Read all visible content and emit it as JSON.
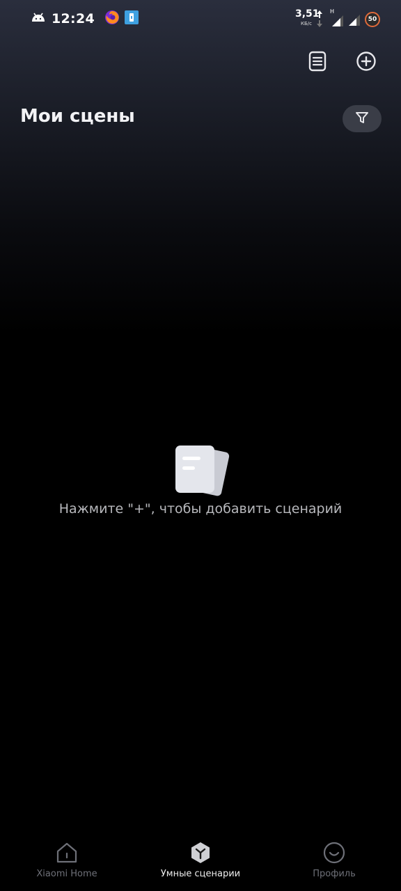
{
  "status_bar": {
    "time": "12:24",
    "net_speed": "3,51",
    "net_speed_unit": "КБ/с",
    "network_type": "H",
    "battery": "50",
    "icons": [
      "android-icon",
      "firefox-icon",
      "notification-app-icon",
      "upload-arrow-icon",
      "signal-icon",
      "signal-icon",
      "battery-icon"
    ]
  },
  "header": {
    "title": "Мои сцены",
    "actions": [
      "log-icon",
      "add-icon",
      "filter-icon"
    ]
  },
  "empty_state": {
    "message": "Нажмите \"+\", чтобы добавить сценарий",
    "icon": "empty-documents-icon"
  },
  "bottom_nav": {
    "items": [
      {
        "label": "Xiaomi Home",
        "icon": "home-icon",
        "active": false
      },
      {
        "label": "Умные сценарии",
        "icon": "smart-scenes-icon",
        "active": true
      },
      {
        "label": "Профиль",
        "icon": "profile-icon",
        "active": false
      }
    ]
  },
  "colors": {
    "background_top": "#2a2e3d",
    "background": "#000000",
    "filter_button": "#3a3d47",
    "inactive_nav": "#6e7078",
    "battery_ring": "#e06a3a"
  }
}
